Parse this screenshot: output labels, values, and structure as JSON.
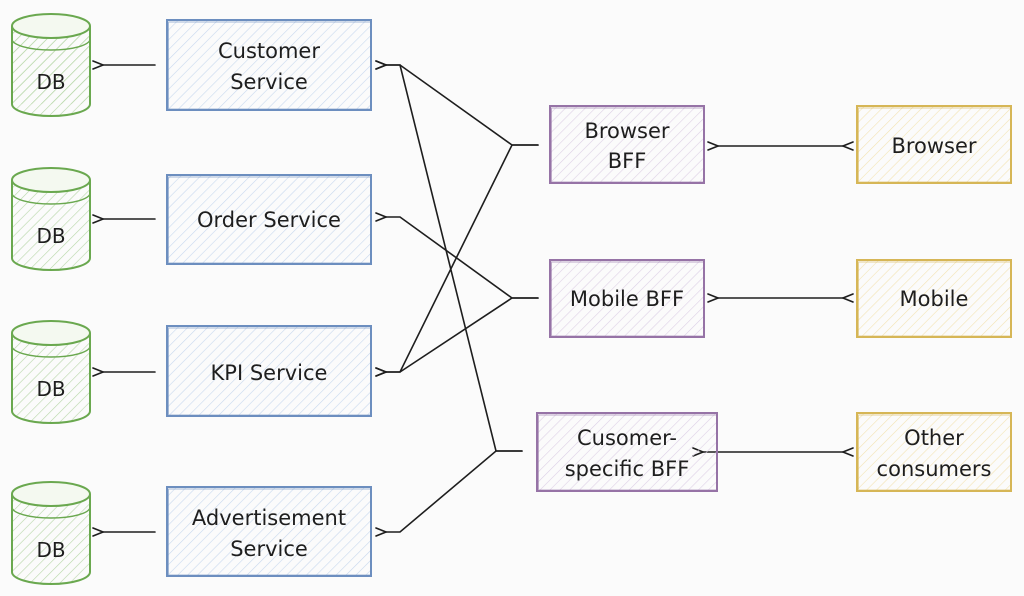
{
  "colors": {
    "db_stroke": "#6aa84f",
    "service_stroke": "#6c8ebf",
    "service_fill": "#dae8fc",
    "bff_stroke": "#9673a6",
    "bff_fill": "#e1d5e7",
    "consumer_stroke": "#d6b656",
    "consumer_fill": "#fff2cc",
    "edge": "#1e1e1e"
  },
  "databases": [
    {
      "id": "db1",
      "label": "DB"
    },
    {
      "id": "db2",
      "label": "DB"
    },
    {
      "id": "db3",
      "label": "DB"
    },
    {
      "id": "db4",
      "label": "DB"
    }
  ],
  "services": [
    {
      "id": "customer",
      "lines": [
        "Customer",
        "Service"
      ]
    },
    {
      "id": "order",
      "lines": [
        "Order Service"
      ]
    },
    {
      "id": "kpi",
      "lines": [
        "KPI Service"
      ]
    },
    {
      "id": "advertisement",
      "lines": [
        "Advertisement",
        "Service"
      ]
    }
  ],
  "bffs": [
    {
      "id": "browser_bff",
      "lines": [
        "Browser",
        "BFF"
      ]
    },
    {
      "id": "mobile_bff",
      "lines": [
        "Mobile BFF"
      ]
    },
    {
      "id": "customer_bff",
      "lines": [
        "Cusomer-",
        "specific BFF"
      ]
    }
  ],
  "consumers": [
    {
      "id": "browser",
      "lines": [
        "Browser"
      ]
    },
    {
      "id": "mobile",
      "lines": [
        "Mobile"
      ]
    },
    {
      "id": "other",
      "lines": [
        "Other",
        "consumers"
      ]
    }
  ],
  "edges": [
    {
      "from": "customer",
      "to": "db1",
      "type": "arrow"
    },
    {
      "from": "order",
      "to": "db2",
      "type": "arrow"
    },
    {
      "from": "kpi",
      "to": "db3",
      "type": "arrow"
    },
    {
      "from": "advertisement",
      "to": "db4",
      "type": "arrow"
    },
    {
      "from": "browser_bff",
      "to": "customer",
      "type": "arrow"
    },
    {
      "from": "browser_bff",
      "to": "kpi",
      "type": "arrow"
    },
    {
      "from": "mobile_bff",
      "to": "order",
      "type": "arrow"
    },
    {
      "from": "mobile_bff",
      "to": "kpi",
      "type": "arrow"
    },
    {
      "from": "customer_bff",
      "to": "customer",
      "type": "arrow"
    },
    {
      "from": "customer_bff",
      "to": "advertisement",
      "type": "arrow"
    },
    {
      "from": "browser_bff",
      "to": "browser",
      "type": "bidirectional"
    },
    {
      "from": "mobile_bff",
      "to": "mobile",
      "type": "bidirectional"
    },
    {
      "from": "customer_bff",
      "to": "other",
      "type": "bidirectional"
    }
  ]
}
